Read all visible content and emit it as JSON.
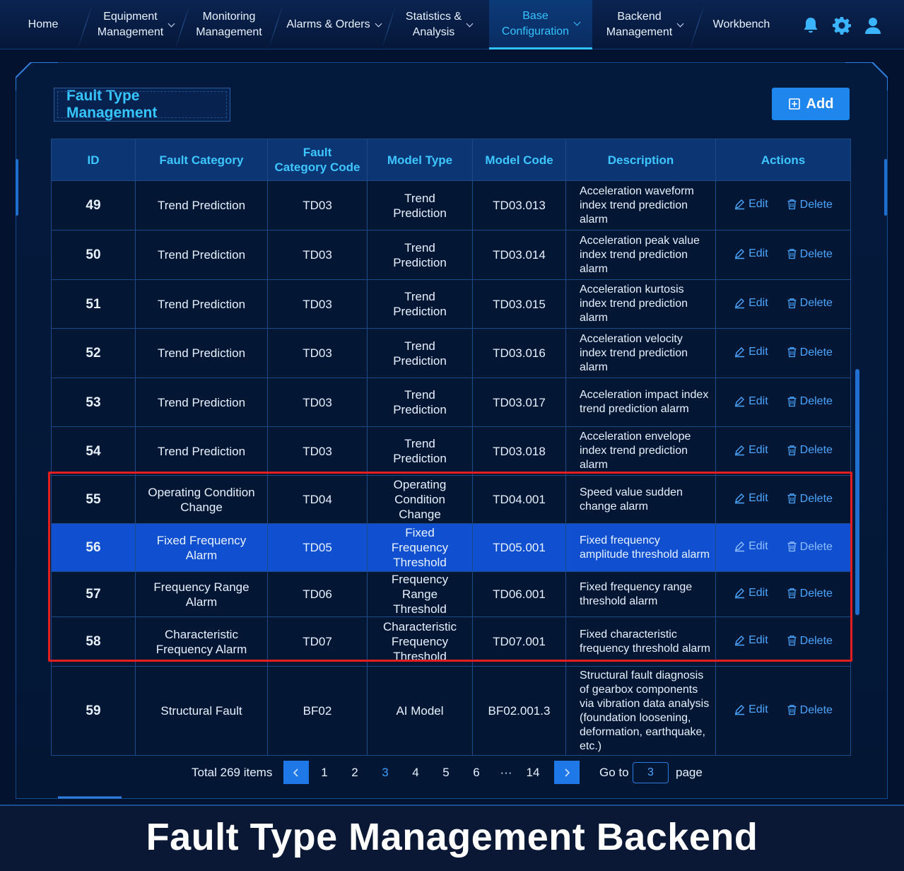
{
  "nav": {
    "home": "Home",
    "equipment": "Equipment\nManagement",
    "monitoring": "Monitoring\nManagement",
    "alarms": "Alarms & Orders",
    "statistics": "Statistics &\nAnalysis",
    "base_config": "Base\nConfiguration",
    "backend": "Backend\nManagement",
    "workbench": "Workbench",
    "icons": [
      "bell-icon",
      "gear-icon",
      "user-icon"
    ],
    "active_color": "#35c4ff"
  },
  "page": {
    "title": "Fault Type Management",
    "add_label": "Add"
  },
  "table": {
    "headers": {
      "id": "ID",
      "category": "Fault Category",
      "category_code_1": "Fault",
      "category_code_2": "Category Code",
      "model_type": "Model Type",
      "model_code": "Model Code",
      "description": "Description",
      "actions": "Actions"
    },
    "edit_label": "Edit",
    "delete_label": "Delete",
    "rows": [
      {
        "id": "49",
        "category": "Trend Prediction",
        "code": "TD03",
        "model_type": "Trend Prediction",
        "model_code": "TD03.013",
        "description": "Acceleration waveform index trend prediction alarm"
      },
      {
        "id": "50",
        "category": "Trend Prediction",
        "code": "TD03",
        "model_type": "Trend Prediction",
        "model_code": "TD03.014",
        "description": "Acceleration peak value index trend prediction alarm"
      },
      {
        "id": "51",
        "category": "Trend Prediction",
        "code": "TD03",
        "model_type": "Trend Prediction",
        "model_code": "TD03.015",
        "description": "Acceleration kurtosis index trend prediction alarm"
      },
      {
        "id": "52",
        "category": "Trend Prediction",
        "code": "TD03",
        "model_type": "Trend Prediction",
        "model_code": "TD03.016",
        "description": "Acceleration velocity index trend prediction alarm"
      },
      {
        "id": "53",
        "category": "Trend Prediction",
        "code": "TD03",
        "model_type": "Trend Prediction",
        "model_code": "TD03.017",
        "description": "Acceleration impact index trend prediction alarm"
      },
      {
        "id": "54",
        "category": "Trend Prediction",
        "code": "TD03",
        "model_type": "Trend Prediction",
        "model_code": "TD03.018",
        "description": "Acceleration envelope index trend prediction alarm"
      },
      {
        "id": "55",
        "category": "Operating Condition Change",
        "code": "TD04",
        "model_type": "Operating Condition Change",
        "model_code": "TD04.001",
        "description": "Speed value sudden change alarm"
      },
      {
        "id": "56",
        "category": "Fixed Frequency Alarm",
        "code": "TD05",
        "model_type": "Fixed Frequency Threshold",
        "model_code": "TD05.001",
        "description": "Fixed frequency amplitude threshold alarm",
        "selected": true
      },
      {
        "id": "57",
        "category": "Frequency Range Alarm",
        "code": "TD06",
        "model_type": "Frequency Range Threshold",
        "model_code": "TD06.001",
        "description": "Fixed frequency range threshold alarm"
      },
      {
        "id": "58",
        "category": "Characteristic Frequency Alarm",
        "code": "TD07",
        "model_type": "Characteristic Frequency Threshold",
        "model_code": "TD07.001",
        "description": "Fixed characteristic frequency threshold alarm"
      },
      {
        "id": "59",
        "category": "Structural Fault",
        "code": "BF02",
        "model_type": "AI Model",
        "model_code": "BF02.001.3",
        "description": "Structural fault diagnosis of gearbox components via vibration data analysis (foundation loosening, deformation, earthquake, etc.)"
      }
    ],
    "highlight_color": "#e21e1e",
    "selected_row_color": "#0f4fd0"
  },
  "pagination": {
    "total_text": "Total 269 items",
    "pages": [
      "1",
      "2",
      "3",
      "4",
      "5",
      "6",
      "···",
      "14"
    ],
    "current": "3",
    "goto_label": "Go to",
    "goto_value": "3",
    "page_label": "page"
  },
  "caption": "Fault Type Management Backend"
}
